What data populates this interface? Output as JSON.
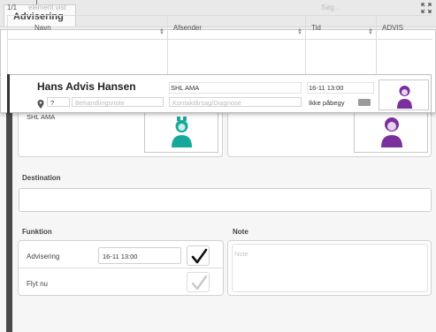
{
  "tab": {
    "label": "Advisering"
  },
  "list": {
    "count": "1/1",
    "count_label": "element vist",
    "search_placeholder": "Søg...",
    "columns": [
      {
        "label": "Navn"
      },
      {
        "label": "Afsender"
      },
      {
        "label": "Tid"
      },
      {
        "label": "ADVIS"
      }
    ],
    "row": {
      "name": "Hans Advis Hansen",
      "sender": "SHL AMA",
      "time": "16-11 13:00",
      "priority": "?",
      "note_placeholder": "Behandlingsnote",
      "reason_placeholder": "Kontaktårsag/Diagnose",
      "status": "Ikke påbegy",
      "logo_icon": "purple-person-icon"
    }
  },
  "form": {
    "sender_text": "SHL AMA",
    "sender_icon": "teal-person-icon",
    "receiver_icon": "purple-person-icon",
    "destination_label": "Destination",
    "funktion_label": "Funktion",
    "note_label": "Note",
    "note_placeholder": "Note",
    "rows": [
      {
        "label": "Advisering",
        "time": "16-11 13:00",
        "checked": true
      },
      {
        "label": "Flyt nu",
        "time": "",
        "checked": false
      }
    ]
  },
  "colors": {
    "teal": "#16a89a",
    "purple": "#7b2f9c",
    "dark_strip": "#4a4a4a"
  }
}
